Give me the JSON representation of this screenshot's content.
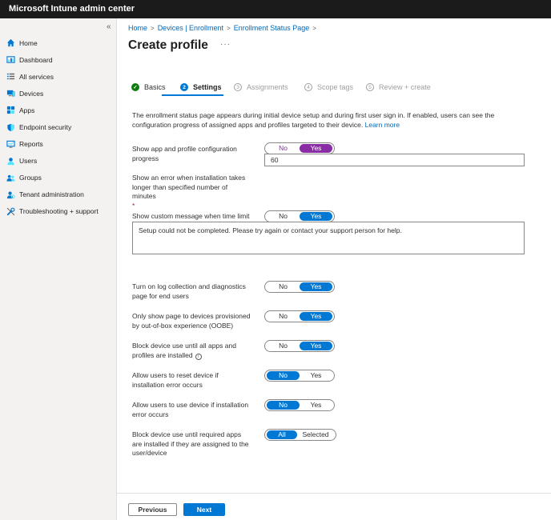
{
  "app": {
    "title": "Microsoft Intune admin center"
  },
  "sidebar": {
    "collapse_glyph": "«",
    "items": [
      {
        "label": "Home",
        "icon": "home-icon"
      },
      {
        "label": "Dashboard",
        "icon": "dashboard-icon"
      },
      {
        "label": "All services",
        "icon": "list-icon"
      },
      {
        "label": "Devices",
        "icon": "device-icon"
      },
      {
        "label": "Apps",
        "icon": "apps-grid-icon"
      },
      {
        "label": "Endpoint security",
        "icon": "shield-icon"
      },
      {
        "label": "Reports",
        "icon": "reports-icon"
      },
      {
        "label": "Users",
        "icon": "user-icon"
      },
      {
        "label": "Groups",
        "icon": "groups-icon"
      },
      {
        "label": "Tenant administration",
        "icon": "tenant-admin-icon"
      },
      {
        "label": "Troubleshooting + support",
        "icon": "wrench-icon"
      }
    ]
  },
  "breadcrumb": {
    "items": [
      "Home",
      "Devices | Enrollment",
      "Enrollment Status Page"
    ]
  },
  "page": {
    "title": "Create profile",
    "more": "···"
  },
  "steps": [
    {
      "label": "Basics",
      "state": "done",
      "marker": "✓"
    },
    {
      "label": "Settings",
      "state": "active",
      "marker": "2"
    },
    {
      "label": "Assignments",
      "state": "pending",
      "marker": "3"
    },
    {
      "label": "Scope tags",
      "state": "pending",
      "marker": "4"
    },
    {
      "label": "Review + create",
      "state": "pending",
      "marker": "5"
    }
  ],
  "intro": {
    "text": "The enrollment status page appears during initial device setup and during first user sign in. If enabled, users can see the configuration progress of assigned apps and profiles targeted to their device.",
    "link": "Learn more"
  },
  "settings": {
    "show_progress": {
      "label": "Show app and profile configuration progress",
      "options": [
        "No",
        "Yes"
      ],
      "selected": "Yes"
    },
    "error_minutes": {
      "label": "Show an error when installation takes longer than specified number of minutes",
      "required": "*",
      "value": "60"
    },
    "custom_message": {
      "label": "Show custom message when time limit or error occurs",
      "options": [
        "No",
        "Yes"
      ],
      "selected": "Yes",
      "message": "Setup could not be completed. Please try again or contact your support person for help."
    },
    "log_collection": {
      "label": "Turn on log collection and diagnostics page for end users",
      "options": [
        "No",
        "Yes"
      ],
      "selected": "Yes"
    },
    "oobe_only": {
      "label": "Only show page to devices provisioned by out-of-box experience (OOBE)",
      "options": [
        "No",
        "Yes"
      ],
      "selected": "Yes"
    },
    "block_until_installed": {
      "label": "Block device use until all apps and profiles are installed",
      "info": "i",
      "options": [
        "No",
        "Yes"
      ],
      "selected": "Yes"
    },
    "allow_reset": {
      "label": "Allow users to reset device if installation error occurs",
      "options": [
        "No",
        "Yes"
      ],
      "selected": "No"
    },
    "allow_use": {
      "label": "Allow users to use device if installation error occurs",
      "options": [
        "No",
        "Yes"
      ],
      "selected": "No"
    },
    "block_required_apps": {
      "label": "Block device use until required apps are installed if they are assigned to the user/device",
      "options": [
        "All",
        "Selected"
      ],
      "selected": "All"
    }
  },
  "footer": {
    "previous": "Previous",
    "next": "Next"
  },
  "colors": {
    "accent": "#0078d4",
    "purple_accent": "#8a2da5",
    "success": "#107c10",
    "topbar": "#1b1b1b"
  }
}
